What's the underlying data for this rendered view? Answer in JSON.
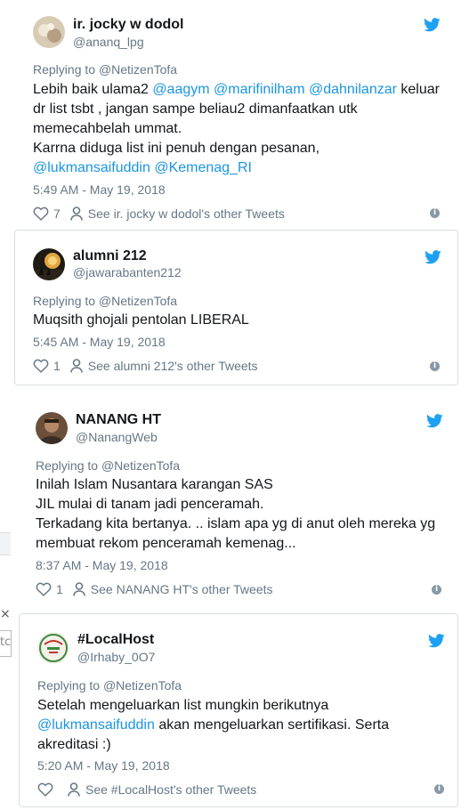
{
  "tweets": [
    {
      "name": "ir. jocky w dodol",
      "handle": "@ananq_lpg",
      "reply_prefix": "Replying to ",
      "reply_to": "@NetizenTofa",
      "lines": [
        [
          {
            "t": "Lebih baik ulama2 "
          },
          {
            "t": "@aagym",
            "m": true
          },
          {
            "t": " "
          },
          {
            "t": "@marifinilham",
            "m": true
          },
          {
            "t": " "
          },
          {
            "t": "@dahnilanzar",
            "m": true
          },
          {
            "t": " keluar"
          }
        ],
        [
          {
            "t": "dr list tsbt , jangan sampe beliau2 dimanfaatkan utk"
          }
        ],
        [
          {
            "t": "memecahbelah ummat."
          }
        ],
        [
          {
            "t": "Karrna diduga list ini penuh dengan pesanan,"
          }
        ],
        [
          {
            "t": "@lukmansaifuddin",
            "m": true
          },
          {
            "t": " "
          },
          {
            "t": "@Kemenag_RI",
            "m": true
          }
        ]
      ],
      "time": "5:49 AM - May 19, 2018",
      "likes": "7",
      "see_other": "See ir. jocky w dodol's other Tweets"
    },
    {
      "name": "alumni 212",
      "handle": "@jawarabanten212",
      "reply_prefix": "Replying to ",
      "reply_to": "@NetizenTofa",
      "lines": [
        [
          {
            "t": "Muqsith ghojali pentolan LIBERAL"
          }
        ]
      ],
      "time": "5:45 AM - May 19, 2018",
      "likes": "1",
      "see_other": "See alumni 212's other Tweets"
    },
    {
      "name": "NANANG HT",
      "handle": "@NanangWeb",
      "reply_prefix": "Replying to ",
      "reply_to": "@NetizenTofa",
      "lines": [
        [
          {
            "t": "Inilah Islam Nusantara karangan SAS"
          }
        ],
        [
          {
            "t": "JIL mulai di tanam jadi penceramah."
          }
        ],
        [
          {
            "t": "Terkadang kita bertanya. .. islam apa yg di anut oleh mereka yg"
          }
        ],
        [
          {
            "t": "membuat rekom penceramah kemenag..."
          }
        ]
      ],
      "time": "8:37 AM - May 19, 2018",
      "likes": "1",
      "see_other": "See NANANG HT's other Tweets"
    },
    {
      "name": "#LocalHost",
      "handle": "@Irhaby_0O7",
      "reply_prefix": "Replying to ",
      "reply_to": "@NetizenTofa",
      "lines": [
        [
          {
            "t": "Setelah mengeluarkan list mungkin berikutnya"
          }
        ],
        [
          {
            "t": "@lukmansaifuddin",
            "m": true
          },
          {
            "t": " akan mengeluarkan sertifikasi. Serta"
          }
        ],
        [
          {
            "t": "akreditasi :)"
          }
        ]
      ],
      "time": "5:20 AM - May 19, 2018",
      "likes": "",
      "see_other": "See #LocalHost's other Tweets"
    }
  ],
  "edge_fragments": {
    "close": "×",
    "text": "tc"
  },
  "colors": {
    "mention": "#1b95e0",
    "muted": "#657786",
    "bird": "#1da1f2"
  }
}
